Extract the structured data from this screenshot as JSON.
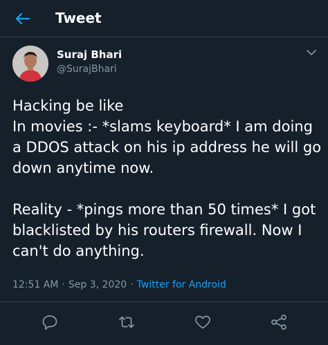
{
  "header": {
    "title": "Tweet",
    "back_icon": "arrow-left-icon"
  },
  "author": {
    "display_name": "Suraj Bhari",
    "handle": "@SurajBhari",
    "menu_icon": "chevron-down-icon"
  },
  "tweet": {
    "lines": [
      "Hacking be like",
      "In movies :- *slams keyboard* I am doing a DDOS attack on his ip address he will go down anytime now."
    ],
    "lines2": [
      "Reality - *pings more than 50 times* I got blacklisted by his routers firewall. Now I can't do anything."
    ]
  },
  "meta": {
    "time": "12:51 AM",
    "separator": "·",
    "date": "Sep 3, 2020",
    "source": "Twitter for Android"
  },
  "actions": [
    {
      "icon": "reply-icon"
    },
    {
      "icon": "retweet-icon"
    },
    {
      "icon": "like-icon"
    },
    {
      "icon": "share-icon"
    }
  ],
  "colors": {
    "background": "#15202b",
    "text": "#ffffff",
    "muted": "#8899a6",
    "accent": "#1da1f2",
    "border": "#38444d"
  }
}
